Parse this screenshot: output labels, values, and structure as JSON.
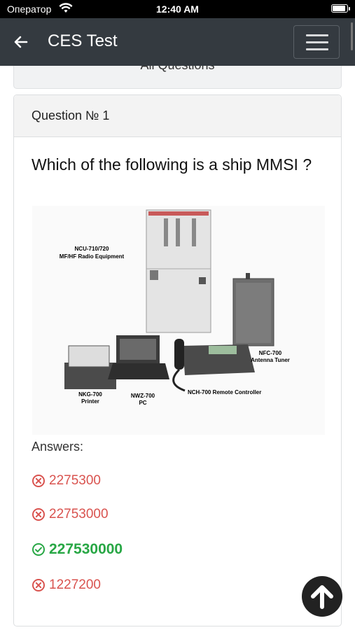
{
  "status_bar": {
    "carrier": "Оператор",
    "time": "12:40 AM"
  },
  "navbar": {
    "title": "CES Test"
  },
  "prev_card": {
    "label": "All Questions"
  },
  "question_card": {
    "header": "Question № 1",
    "question": "Which of the following is a ship MMSI ?",
    "figure_labels": {
      "ncu": "NCU-710/720",
      "ncu_sub": "MF/HF Radio Equipment",
      "nfc": "NFC-700",
      "nfc_sub": "Antenna Tuner",
      "nkg": "NKG-700",
      "nkg_sub": "Printer",
      "nwz": "NWZ-700",
      "nwz_sub": "PC",
      "nch": "NCH-700 Remote Controller"
    },
    "answers_label": "Answers:",
    "answers": [
      {
        "text": "2275300",
        "correct": false
      },
      {
        "text": "22753000",
        "correct": false
      },
      {
        "text": "227530000",
        "correct": true
      },
      {
        "text": "1227200",
        "correct": false
      }
    ]
  },
  "colors": {
    "navbar": "#343a40",
    "wrong": "#d9534f",
    "correct": "#28a745"
  }
}
